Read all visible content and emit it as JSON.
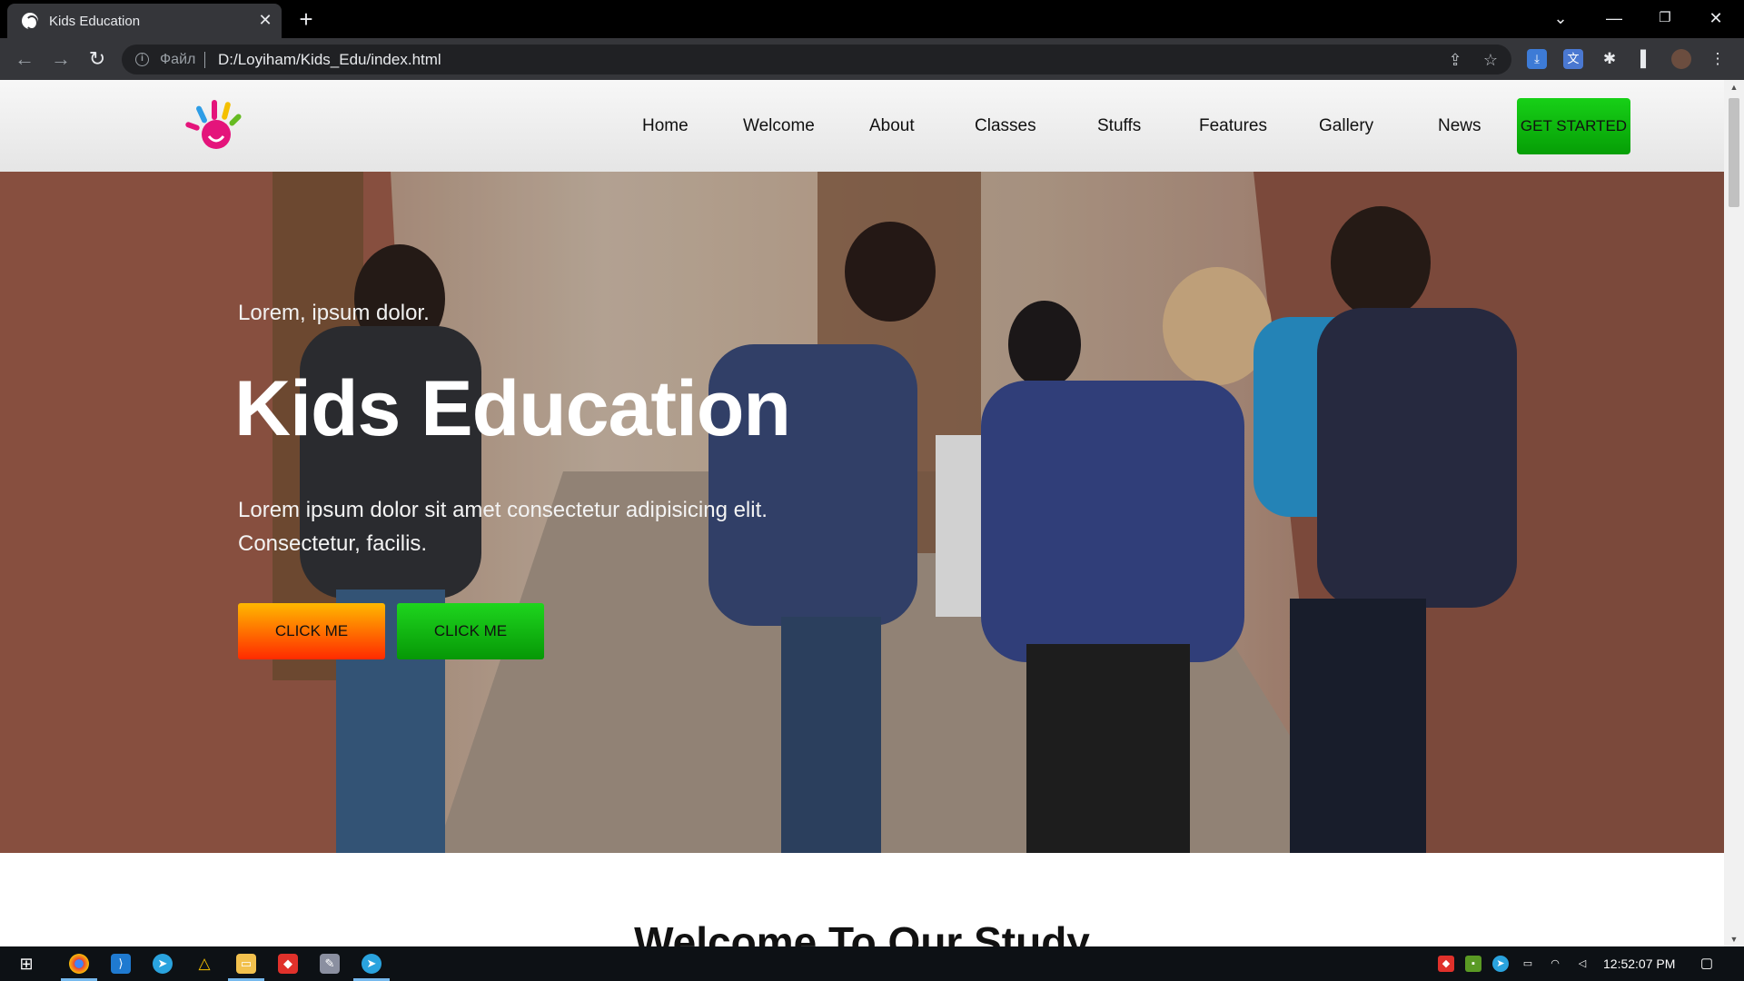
{
  "browser": {
    "tab_title": "Kids Education",
    "tab_close": "✕",
    "new_tab": "+",
    "scheme_label": "Файл",
    "url": "D:/Loyiham/Kids_Edu/index.html"
  },
  "site": {
    "nav": [
      {
        "label": "Home"
      },
      {
        "label": "Welcome"
      },
      {
        "label": "About"
      },
      {
        "label": "Classes"
      },
      {
        "label": "Stuffs"
      },
      {
        "label": "Features"
      },
      {
        "label": "Gallery"
      },
      {
        "label": "News"
      }
    ],
    "cta": "GET STARTED"
  },
  "hero": {
    "kicker": "Lorem, ipsum dolor.",
    "title": "Kids Education",
    "text": "Lorem ipsum dolor sit amet consectetur adipisicing elit. Consectetur, facilis.",
    "button_primary": "CLICK ME",
    "button_secondary": "CLICK ME"
  },
  "section": {
    "title": "Welcome To Our Study"
  },
  "taskbar": {
    "clock": "12:52:07 PM"
  },
  "colors": {
    "cta_green": "#0bb80b",
    "btn_orange": "#ff6a00",
    "chrome_dark": "#35363a"
  },
  "icons": [
    "windows-start-icon",
    "chrome-icon",
    "vscode-icon",
    "telegram-icon",
    "drive-icon",
    "file-explorer-icon",
    "anydesk-icon",
    "app-icon"
  ]
}
